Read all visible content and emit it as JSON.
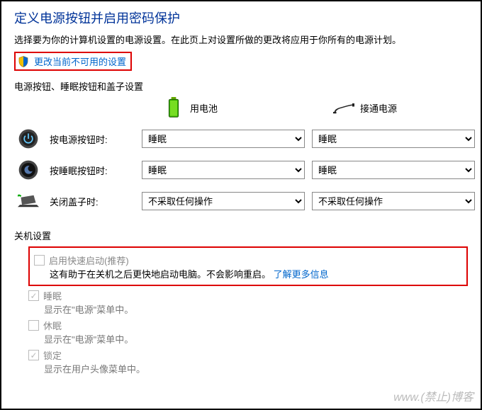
{
  "title": "定义电源按钮并启用密码保护",
  "subtitle": "选择要为你的计算机设置的电源设置。在此页上对设置所做的更改将应用于你所有的电源计划。",
  "change_link": "更改当前不可用的设置",
  "section_buttons_title": "电源按钮、睡眠按钮和盖子设置",
  "col_battery": "用电池",
  "col_plugged": "接通电源",
  "rows": {
    "power": {
      "label": "按电源按钮时:",
      "battery": "睡眠",
      "plugged": "睡眠"
    },
    "sleep": {
      "label": "按睡眠按钮时:",
      "battery": "睡眠",
      "plugged": "睡眠"
    },
    "lid": {
      "label": "关闭盖子时:",
      "battery": "不采取任何操作",
      "plugged": "不采取任何操作"
    }
  },
  "options": {
    "sleep": "睡眠",
    "none": "不采取任何操作"
  },
  "shutdown_title": "关机设置",
  "fast_startup": {
    "label": "启用快速启动(推荐)",
    "desc_prefix": "这有助于在关机之后更快地启动电脑。不会影响重启。",
    "learn_more": "了解更多信息"
  },
  "sleep_chk": {
    "label": "睡眠",
    "desc": "显示在\"电源\"菜单中。"
  },
  "hibernate_chk": {
    "label": "休眠",
    "desc": "显示在\"电源\"菜单中。"
  },
  "lock_chk": {
    "label": "锁定",
    "desc": "显示在用户头像菜单中。"
  },
  "watermark": "www.(禁止)博客"
}
